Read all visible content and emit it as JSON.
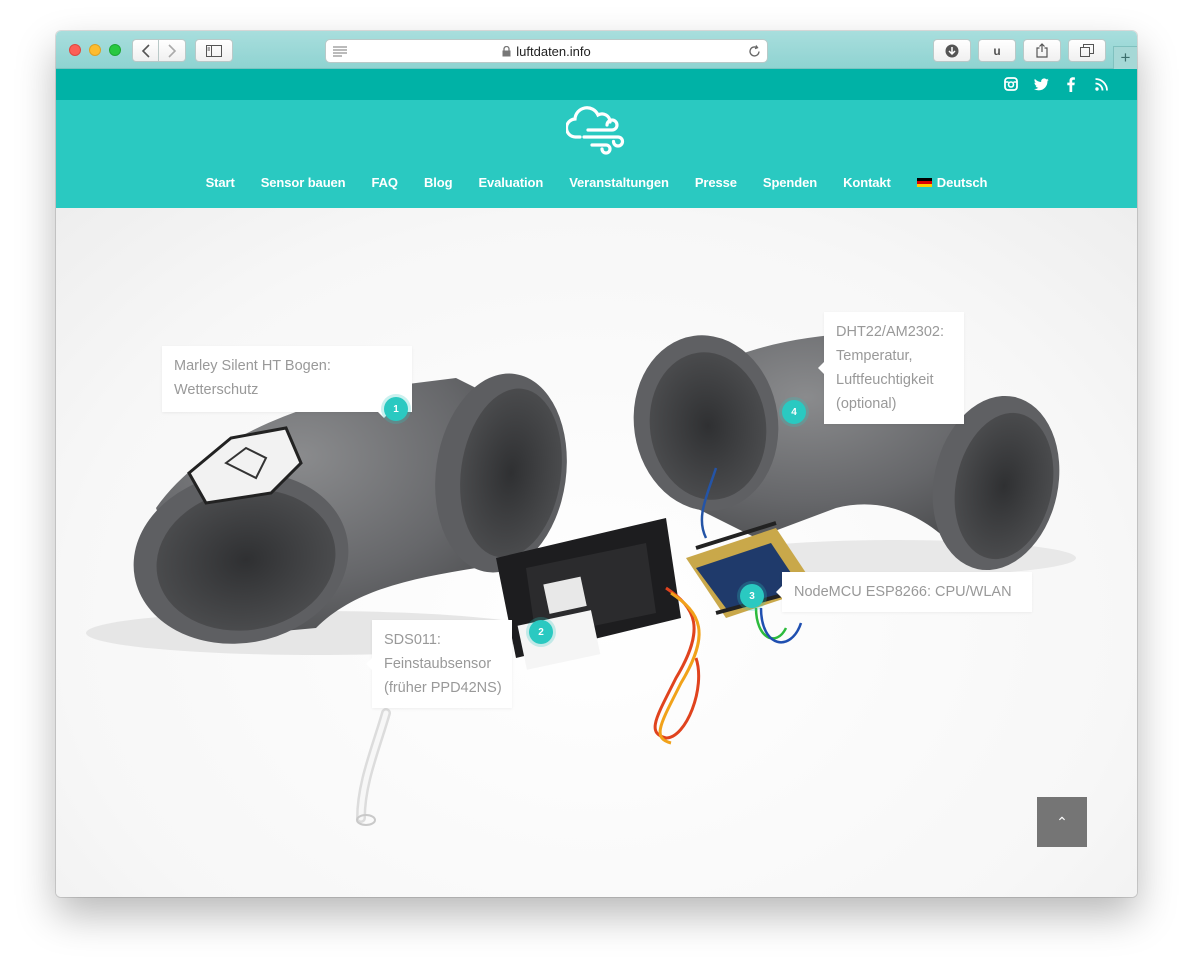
{
  "browser": {
    "url": "luftdaten.info",
    "toolbar_icons": [
      "back-icon",
      "forward-icon",
      "sidebar-icon",
      "reader-icon",
      "lock-icon",
      "reload-icon",
      "download-icon",
      "extension-u-icon",
      "share-icon",
      "tabs-icon",
      "new-tab-icon"
    ],
    "extension_label": "u",
    "new_tab_label": "+"
  },
  "social": [
    "instagram-icon",
    "twitter-icon",
    "facebook-icon",
    "rss-icon"
  ],
  "nav": {
    "items": [
      "Start",
      "Sensor bauen",
      "FAQ",
      "Blog",
      "Evaluation",
      "Veranstaltungen",
      "Presse",
      "Spenden",
      "Kontakt"
    ],
    "language": "Deutsch"
  },
  "hotspots": [
    {
      "number": "1",
      "lines": [
        "Marley Silent HT Bogen:",
        "Wetterschutz"
      ]
    },
    {
      "number": "2",
      "lines": [
        "SDS011:",
        "Feinstaubsensor",
        "(früher PPD42NS)"
      ]
    },
    {
      "number": "3",
      "lines": [
        "NodeMCU ESP8266: CPU/WLAN"
      ]
    },
    {
      "number": "4",
      "lines": [
        "DHT22/AM2302:",
        "Temperatur,",
        "Luftfeuchtigkeit",
        "(optional)"
      ]
    }
  ],
  "colors": {
    "topbar": "#00b2a6",
    "header": "#2ac9c1",
    "accent": "#2ac9c1",
    "pipe": "#6b6c6e",
    "totop": "#757575"
  },
  "scroll_top_icon": "chevron-up-icon",
  "scroll_top_label": "⌃"
}
